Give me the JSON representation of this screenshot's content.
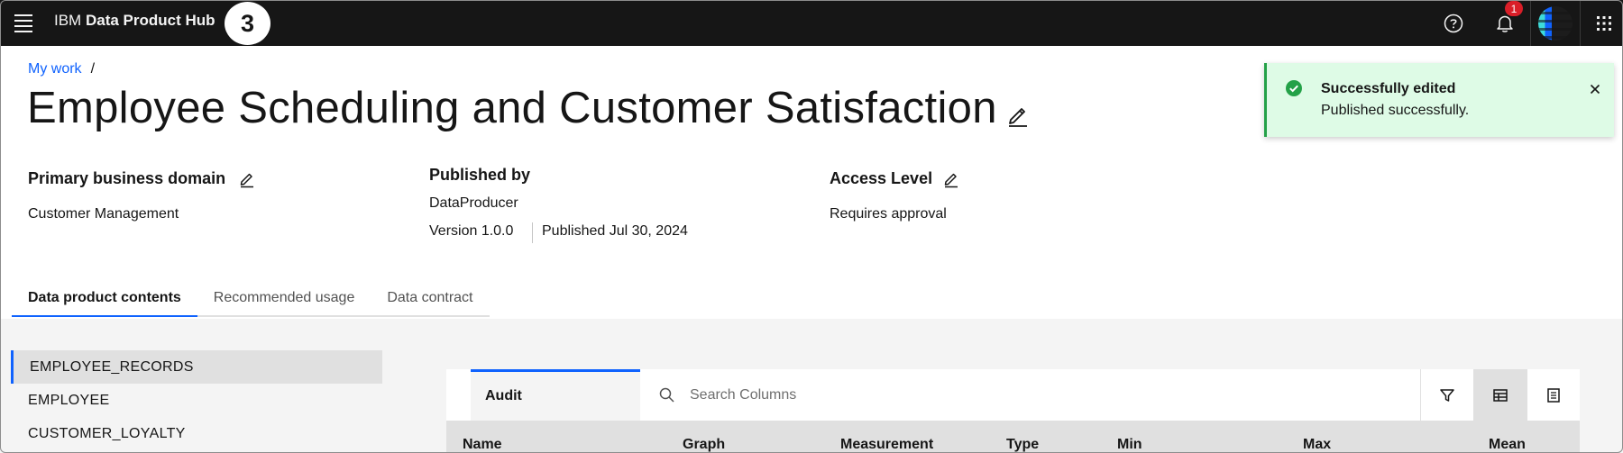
{
  "header": {
    "brand_ibm": "IBM",
    "brand_product": "Data Product Hub",
    "step_badge": "3",
    "notification_count": "1",
    "icons": [
      "menu-icon",
      "help-icon",
      "notification-icon",
      "avatar",
      "app-switcher-icon"
    ]
  },
  "breadcrumb": {
    "items": [
      {
        "label": "My work"
      }
    ],
    "separator": "/"
  },
  "page": {
    "title": "Employee Scheduling and Customer Satisfaction"
  },
  "meta": {
    "domain_label": "Primary business domain",
    "domain_value": "Customer Management",
    "published_by_label": "Published by",
    "published_by_value": "DataProducer",
    "version": "Version 1.0.0",
    "published_date": "Published Jul 30, 2024",
    "access_label": "Access Level",
    "access_value": "Requires approval"
  },
  "tabs": [
    {
      "label": "Data product contents",
      "active": true
    },
    {
      "label": "Recommended usage",
      "active": false
    },
    {
      "label": "Data contract",
      "active": false
    }
  ],
  "assets": [
    {
      "label": "EMPLOYEE_RECORDS",
      "selected": true
    },
    {
      "label": "EMPLOYEE",
      "selected": false
    },
    {
      "label": "CUSTOMER_LOYALTY",
      "selected": false
    }
  ],
  "toolbar": {
    "audit_label": "Audit",
    "search_placeholder": "Search Columns"
  },
  "table": {
    "columns": [
      "Name",
      "Graph",
      "Measurement",
      "Type",
      "Min",
      "Max",
      "Mean"
    ]
  },
  "toast": {
    "title": "Successfully edited",
    "subtitle": "Published successfully."
  },
  "colors": {
    "header_bg": "#161616",
    "link": "#0f62fe",
    "success": "#24a148",
    "toast_bg": "#defbe6",
    "badge": "#da1e28"
  }
}
